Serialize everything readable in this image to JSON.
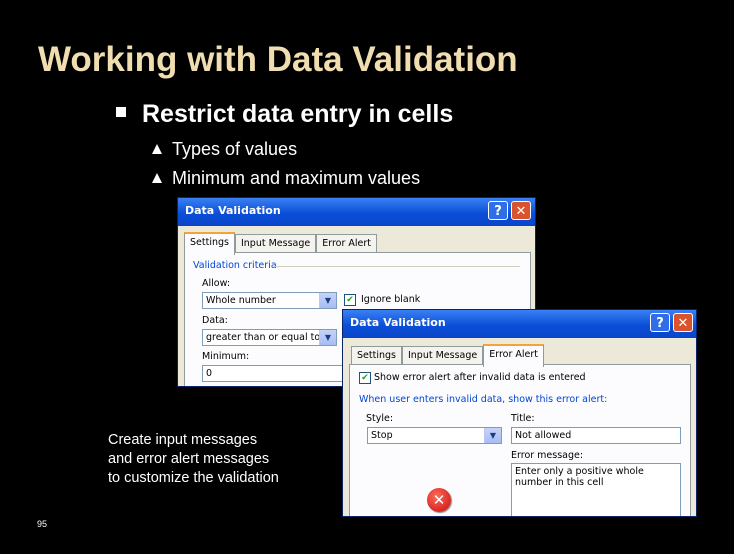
{
  "slide": {
    "title": "Working with Data Validation",
    "bullet": "Restrict data entry in cells",
    "subbullets": [
      "Types of values",
      "Minimum and maximum values"
    ],
    "caption": [
      "Create input messages",
      "and error alert messages",
      "to customize the validation"
    ],
    "page_number": "95"
  },
  "dialog1": {
    "title": "Data Validation",
    "tabs": [
      "Settings",
      "Input Message",
      "Error Alert"
    ],
    "active_tab": "Settings",
    "group_label": "Validation criteria",
    "allow_label": "Allow:",
    "allow_value": "Whole number",
    "ignore_blank_label": "Ignore blank",
    "data_label": "Data:",
    "data_value": "greater than or equal to",
    "minimum_label": "Minimum:",
    "minimum_value": "0"
  },
  "dialog2": {
    "title": "Data Validation",
    "tabs": [
      "Settings",
      "Input Message",
      "Error Alert"
    ],
    "active_tab": "Error Alert",
    "show_alert_label": "Show error alert after invalid data is entered",
    "group_label": "When user enters invalid data, show this error alert:",
    "style_label": "Style:",
    "style_value": "Stop",
    "title_label": "Title:",
    "title_value": "Not allowed",
    "message_label": "Error message:",
    "message_value": "Enter only a positive whole number in this cell"
  },
  "icons": {
    "help": "?",
    "close": "✕",
    "dropdown": "▼",
    "check": "✔",
    "error": "✕"
  }
}
